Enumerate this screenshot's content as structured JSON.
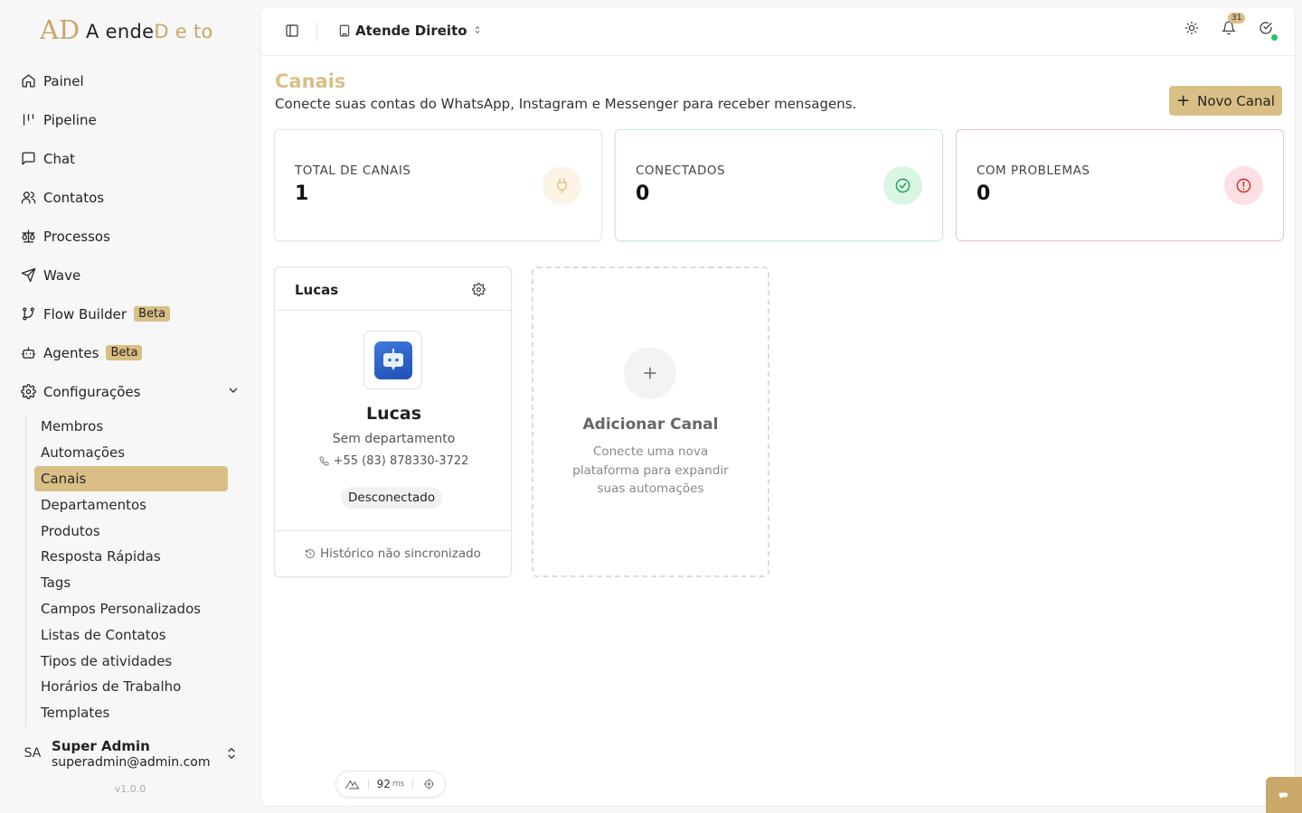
{
  "logo": {
    "mark": "AD",
    "text_a": "A ",
    "text_b": "ende",
    "text_c": "D",
    "text_d": " e to"
  },
  "nav": [
    {
      "label": "Painel",
      "icon": "home-icon"
    },
    {
      "label": "Pipeline",
      "icon": "pipeline-icon"
    },
    {
      "label": "Chat",
      "icon": "chat-icon"
    },
    {
      "label": "Contatos",
      "icon": "users-icon"
    },
    {
      "label": "Processos",
      "icon": "scale-icon"
    },
    {
      "label": "Wave",
      "icon": "send-icon"
    },
    {
      "label": "Flow Builder",
      "badge": "Beta",
      "icon": "flow-icon"
    },
    {
      "label": "Agentes",
      "badge": "Beta",
      "icon": "bot-icon"
    },
    {
      "label": "Configurações",
      "icon": "gear-icon"
    }
  ],
  "subnav": [
    "Membros",
    "Automações",
    "Canais",
    "Departamentos",
    "Produtos",
    "Resposta Rápidas",
    "Tags",
    "Campos Personalizados",
    "Listas de Contatos",
    "Tipos de atividades",
    "Horários de Trabalho",
    "Templates"
  ],
  "subnav_active": "Canais",
  "user": {
    "initials": "SA",
    "name": "Super Admin",
    "email": "superadmin@admin.com"
  },
  "version": "v1.0.0",
  "topbar": {
    "org": "Atende Direito",
    "notifications": "31"
  },
  "page": {
    "title": "Canais",
    "subtitle": "Conecte suas contas do WhatsApp, Instagram e Messenger para receber mensagens.",
    "new_button": "Novo Canal"
  },
  "stats": [
    {
      "label": "TOTAL DE CANAIS",
      "value": "1",
      "icon": "plug-icon"
    },
    {
      "label": "CONECTADOS",
      "value": "0",
      "icon": "check-circle-icon"
    },
    {
      "label": "COM PROBLEMAS",
      "value": "0",
      "icon": "alert-circle-icon"
    }
  ],
  "channel": {
    "header": "Lucas",
    "name": "Lucas",
    "department": "Sem departamento",
    "phone": "+55 (83) 878330-3722",
    "status": "Desconectado",
    "history": "Histórico não sincronizado"
  },
  "add_card": {
    "title": "Adicionar Canal",
    "description": "Conecte uma nova plataforma para expandir suas automações"
  },
  "devbar": {
    "value": "92",
    "unit": "ms"
  },
  "colors": {
    "accent": "#d9bf85",
    "success": "#16a34a",
    "danger": "#dc2626"
  }
}
